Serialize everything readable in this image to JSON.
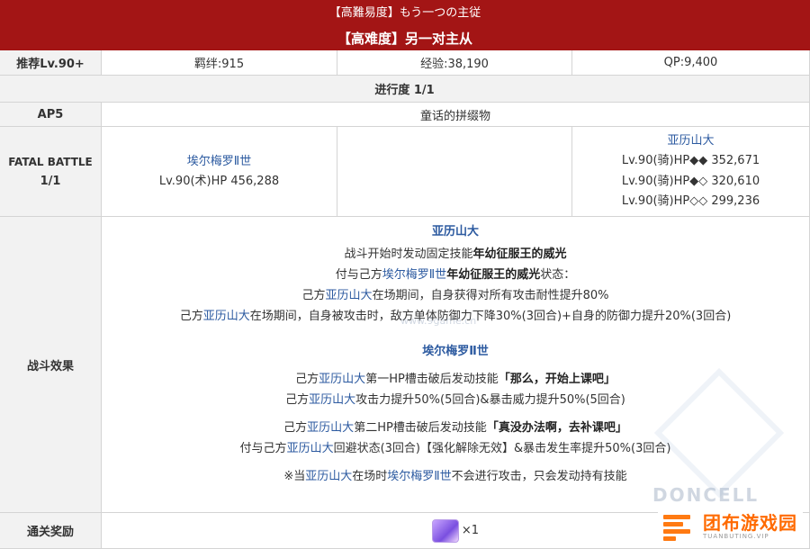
{
  "header": {
    "jp_title": "【高難易度】もう一つの主従",
    "cn_title": "【高难度】另一对主从"
  },
  "summary": {
    "level_label": "推荐Lv.90+",
    "bond": "羁绊:915",
    "exp": "经验:38,190",
    "qp": "QP:9,400"
  },
  "progress": "进行度 1/1",
  "ap": {
    "label": "AP5",
    "value": "童话的拼缀物"
  },
  "battle": {
    "label_line1": "FATAL BATTLE",
    "label_line2": "1/1",
    "enemy1_name": "埃尔梅罗Ⅱ世",
    "enemy1_stats": "Lv.90(术)HP 456,288",
    "enemy2_name": "亚历山大",
    "enemy2_lines": [
      "Lv.90(骑)HP◆◆ 352,671",
      "Lv.90(骑)HP◆◇ 320,610",
      "Lv.90(骑)HP◇◇ 299,236"
    ]
  },
  "effects": {
    "label": "战斗效果",
    "alex_title": "亚历山大",
    "alex_l1_pre": "战斗开始时发动固定技能",
    "alex_l1_bold": "年幼征服王的威光",
    "alex_l2_pre": "付与己方",
    "alex_l2_hl": "埃尔梅罗Ⅱ世",
    "alex_l2_bold": "年幼征服王的威光",
    "alex_l2_post": "状态：",
    "alex_l3_pre": "己方",
    "alex_l3_hl": "亚历山大",
    "alex_l3_post": "在场期间，自身获得对所有攻击耐性提升80%",
    "alex_l4_pre": "己方",
    "alex_l4_hl": "亚历山大",
    "alex_l4_post": "在场期间，自身被攻击时，敌方单体防御力下降30%(3回合)+自身的防御力提升20%(3回合)",
    "el_title": "埃尔梅罗Ⅱ世",
    "el_l1_pre": "己方",
    "el_l1_hl": "亚历山大",
    "el_l1_mid": "第一HP槽击破后发动技能",
    "el_l1_bold": "「那么，开始上课吧」",
    "el_l2_pre": "己方",
    "el_l2_hl": "亚历山大",
    "el_l2_post": "攻击力提升50%(5回合)&暴击威力提升50%(5回合)",
    "el_l3_pre": "己方",
    "el_l3_hl": "亚历山大",
    "el_l3_mid": "第二HP槽击破后发动技能",
    "el_l3_bold": "「真没办法啊，去补课吧」",
    "el_l4_pre": "付与己方",
    "el_l4_hl": "亚历山大",
    "el_l4_post": "回避状态(3回合)【强化解除无效】&暴击发生率提升50%(3回合)",
    "note_pre": "※当",
    "note_hl1": "亚历山大",
    "note_mid": "在场时",
    "note_hl2": "埃尔梅罗Ⅱ世",
    "note_post": "不会进行攻击，只会发动持有技能"
  },
  "reward": {
    "label": "通关奖励",
    "count": "×1"
  },
  "watermarks": {
    "site": "www.9game.cn",
    "brand": "DONCELL"
  },
  "logo": {
    "cn": "团布游戏园",
    "en": "TUANBUTING.VIP"
  },
  "colors": {
    "header_bg": "#a31515",
    "highlight": "#2c5aa0",
    "label_bg": "#f2f2f2"
  }
}
